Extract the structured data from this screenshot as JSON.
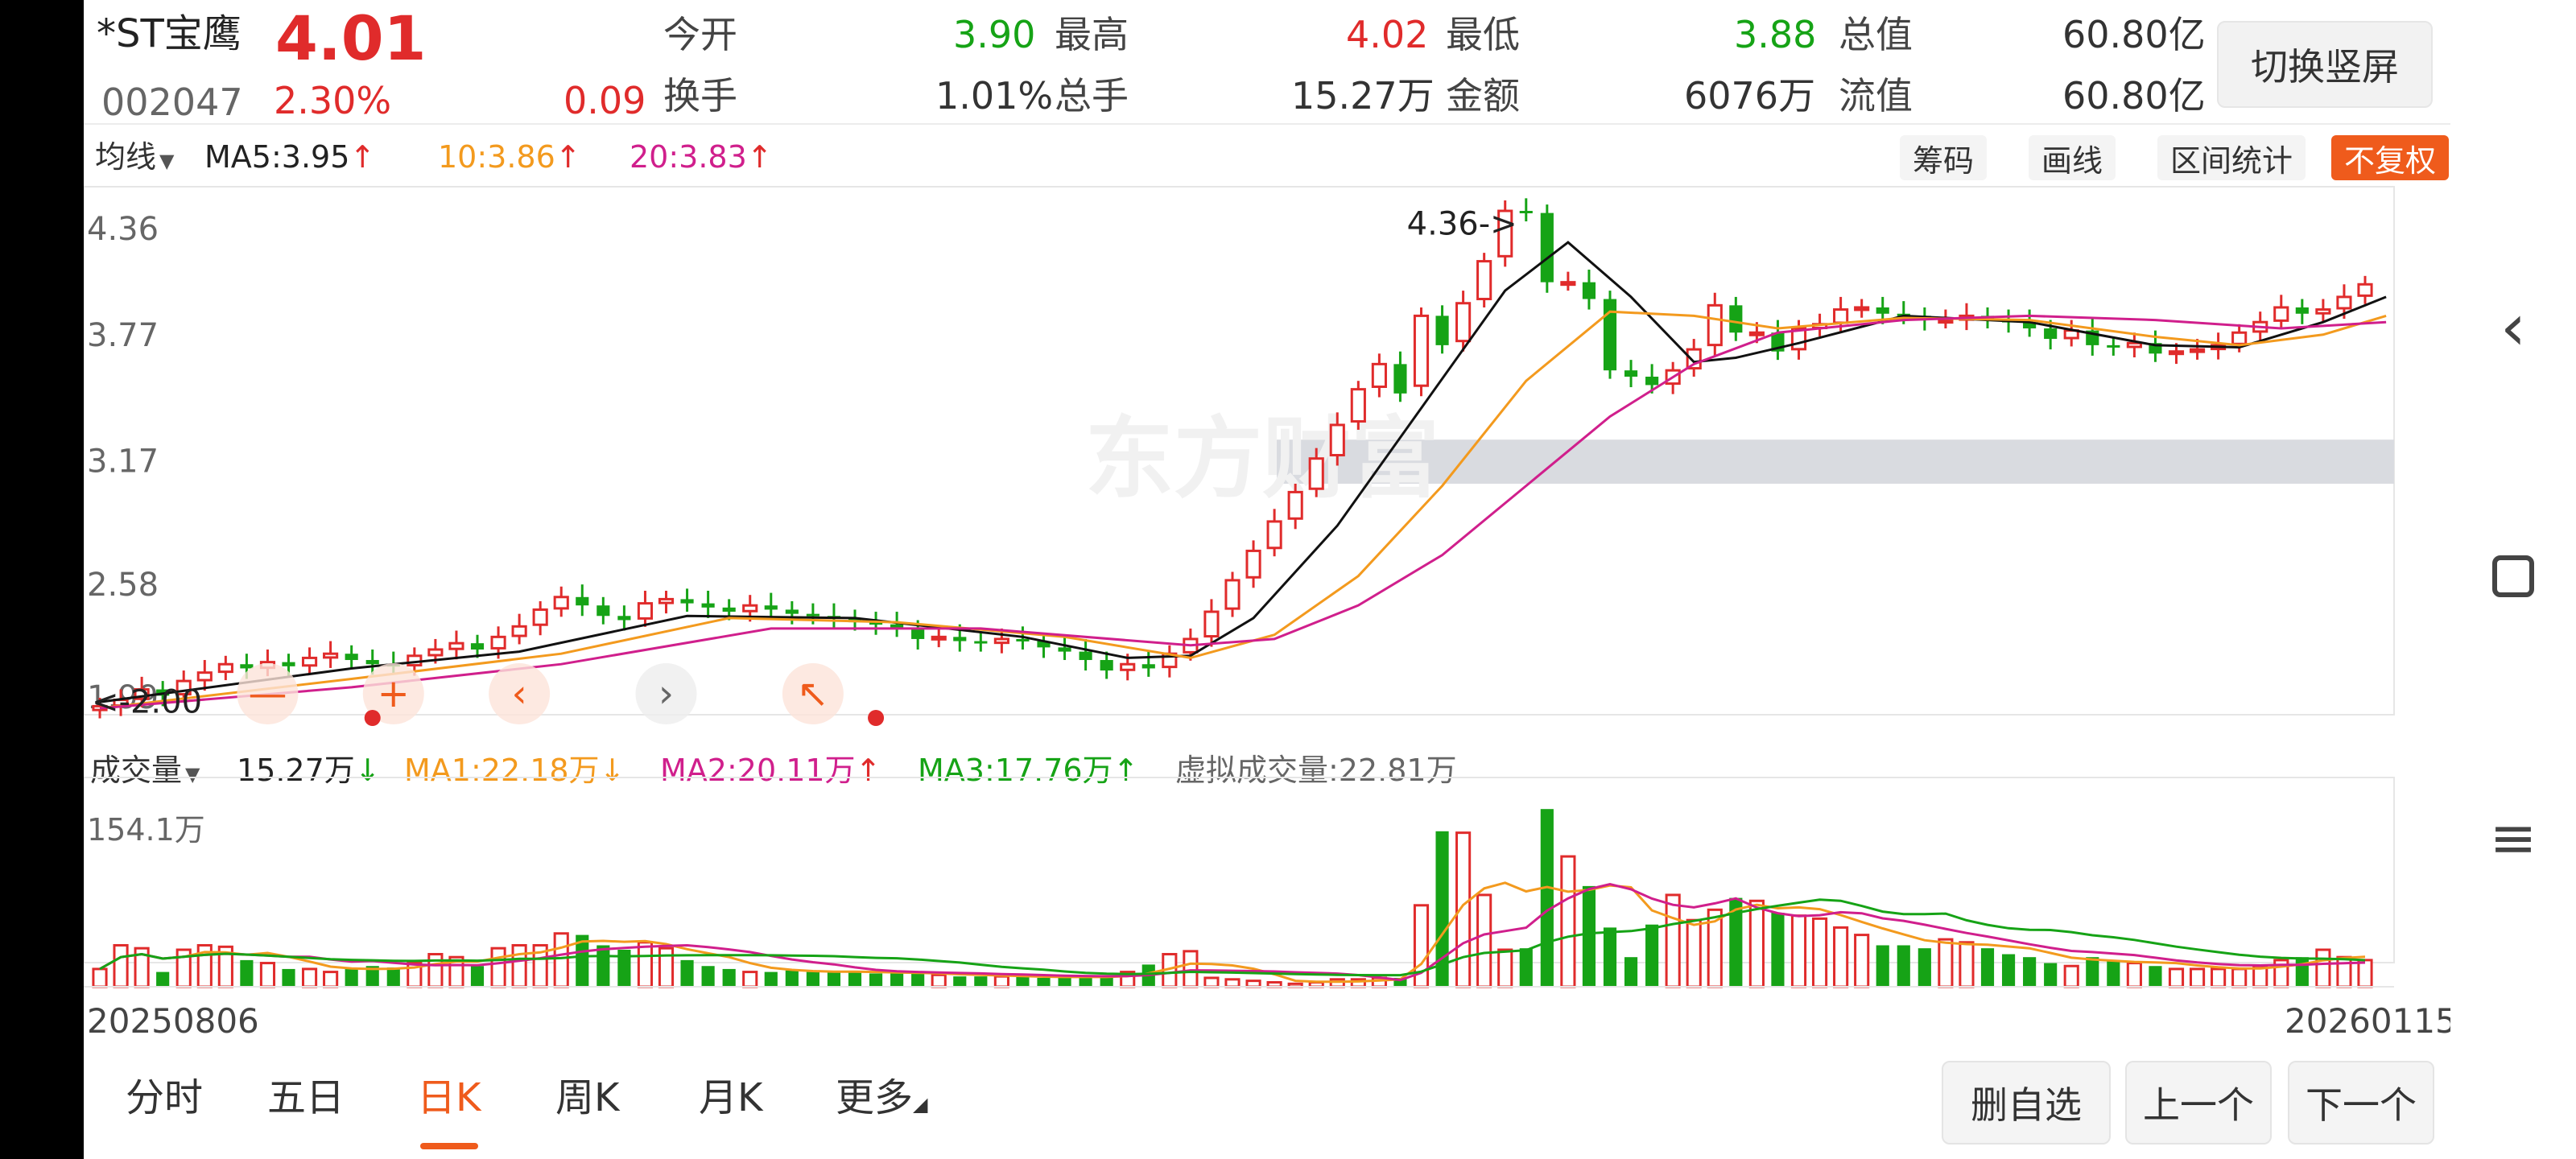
{
  "header": {
    "name": "*ST宝鹰",
    "price": "4.01",
    "code": "002047",
    "change_pct": "2.30%",
    "change": "0.09",
    "open_label": "今开",
    "open": "3.90",
    "high_label": "最高",
    "high": "4.02",
    "low_label": "最低",
    "low": "3.88",
    "mcap_label": "总值",
    "mcap": "60.80亿",
    "turnover_label": "换手",
    "turnover": "1.01%",
    "vol_label": "总手",
    "vol": "15.27万",
    "amount_label": "金额",
    "amount": "6076万",
    "float_label": "流值",
    "float": "60.80亿",
    "switch_label": "切换竖屏"
  },
  "price_bar": {
    "selector": "均线",
    "ma5": "MA5:3.95",
    "ma10": "10:3.86",
    "ma20": "20:3.83",
    "tools": [
      "筹码",
      "画线",
      "区间统计",
      "不复权"
    ]
  },
  "volume_bar": {
    "selector": "成交量",
    "current": "15.27万",
    "ma1": "MA1:22.18万",
    "ma2": "MA2:20.11万",
    "ma3": "MA3:17.76万",
    "virtual": "虚拟成交量:22.81万"
  },
  "dates": {
    "start": "20250806",
    "end": "20260115"
  },
  "tabs": [
    "分时",
    "五日",
    "日K",
    "周K",
    "月K",
    "更多"
  ],
  "active_tab": "日K",
  "bottom_buttons": [
    "删自选",
    "上一个",
    "下一个"
  ],
  "colors": {
    "up": "#e02b2b",
    "down": "#16a316",
    "ma5": "#111111",
    "ma10": "#f39a1e",
    "ma20": "#d01f8c",
    "accent": "#ef5b1c"
  },
  "chart_data": {
    "type": "candlestick",
    "y_ticks": [
      4.36,
      3.77,
      3.17,
      2.58,
      1.99
    ],
    "ylim": [
      1.99,
      4.36
    ],
    "annotations": [
      "4.36->",
      "<-2.00"
    ],
    "closes": [
      2.0,
      2.03,
      2.08,
      2.05,
      2.12,
      2.16,
      2.2,
      2.18,
      2.21,
      2.19,
      2.23,
      2.25,
      2.22,
      2.2,
      2.19,
      2.24,
      2.27,
      2.3,
      2.27,
      2.33,
      2.38,
      2.46,
      2.52,
      2.48,
      2.43,
      2.41,
      2.49,
      2.51,
      2.49,
      2.47,
      2.45,
      2.48,
      2.46,
      2.44,
      2.43,
      2.42,
      2.4,
      2.39,
      2.37,
      2.32,
      2.33,
      2.31,
      2.3,
      2.32,
      2.31,
      2.28,
      2.26,
      2.22,
      2.17,
      2.2,
      2.18,
      2.25,
      2.32,
      2.45,
      2.6,
      2.74,
      2.88,
      3.02,
      3.18,
      3.34,
      3.51,
      3.63,
      3.49,
      3.86,
      3.72,
      3.92,
      4.12,
      4.36,
      4.35,
      4.02,
      4.02,
      3.94,
      3.6,
      3.57,
      3.53,
      3.6,
      3.7,
      3.91,
      3.78,
      3.78,
      3.69,
      3.8,
      3.82,
      3.89,
      3.9,
      3.87,
      3.86,
      3.84,
      3.84,
      3.86,
      3.84,
      3.83,
      3.8,
      3.75,
      3.79,
      3.72,
      3.71,
      3.73,
      3.68,
      3.69,
      3.7,
      3.72,
      3.78,
      3.83,
      3.9,
      3.87,
      3.89,
      3.95,
      4.01
    ],
    "ma_series": [
      {
        "name": "MA5",
        "points": [
          [
            0,
            2.02
          ],
          [
            12,
            2.18
          ],
          [
            20,
            2.26
          ],
          [
            28,
            2.43
          ],
          [
            36,
            2.42
          ],
          [
            44,
            2.33
          ],
          [
            49,
            2.23
          ],
          [
            52,
            2.24
          ],
          [
            55,
            2.42
          ],
          [
            59,
            2.86
          ],
          [
            63,
            3.42
          ],
          [
            67,
            3.98
          ],
          [
            70,
            4.21
          ],
          [
            73,
            3.95
          ],
          [
            76,
            3.64
          ],
          [
            78,
            3.66
          ],
          [
            81,
            3.73
          ],
          [
            86,
            3.86
          ],
          [
            92,
            3.83
          ],
          [
            98,
            3.72
          ],
          [
            102,
            3.71
          ],
          [
            106,
            3.83
          ],
          [
            109,
            3.95
          ]
        ]
      },
      {
        "name": "MA10",
        "points": [
          [
            0,
            1.99
          ],
          [
            12,
            2.13
          ],
          [
            22,
            2.25
          ],
          [
            30,
            2.42
          ],
          [
            38,
            2.4
          ],
          [
            46,
            2.33
          ],
          [
            52,
            2.23
          ],
          [
            56,
            2.34
          ],
          [
            60,
            2.62
          ],
          [
            64,
            3.05
          ],
          [
            68,
            3.55
          ],
          [
            72,
            3.88
          ],
          [
            76,
            3.86
          ],
          [
            80,
            3.8
          ],
          [
            86,
            3.85
          ],
          [
            92,
            3.84
          ],
          [
            98,
            3.76
          ],
          [
            102,
            3.72
          ],
          [
            106,
            3.77
          ],
          [
            109,
            3.86
          ]
        ]
      },
      {
        "name": "MA20",
        "points": [
          [
            0,
            1.99
          ],
          [
            12,
            2.09
          ],
          [
            22,
            2.2
          ],
          [
            32,
            2.37
          ],
          [
            42,
            2.37
          ],
          [
            52,
            2.29
          ],
          [
            56,
            2.32
          ],
          [
            60,
            2.48
          ],
          [
            64,
            2.72
          ],
          [
            68,
            3.05
          ],
          [
            72,
            3.38
          ],
          [
            76,
            3.63
          ],
          [
            80,
            3.78
          ],
          [
            86,
            3.84
          ],
          [
            92,
            3.86
          ],
          [
            98,
            3.84
          ],
          [
            104,
            3.8
          ],
          [
            109,
            3.83
          ]
        ]
      }
    ],
    "volume": {
      "ylim_top": "154.1万",
      "series": [
        {
          "name": "MA1"
        },
        {
          "name": "MA2"
        },
        {
          "name": "MA3"
        }
      ],
      "values": [
        0.12,
        0.28,
        0.26,
        0.1,
        0.25,
        0.28,
        0.27,
        0.18,
        0.16,
        0.12,
        0.12,
        0.1,
        0.12,
        0.14,
        0.13,
        0.16,
        0.22,
        0.2,
        0.14,
        0.26,
        0.28,
        0.28,
        0.36,
        0.35,
        0.28,
        0.25,
        0.3,
        0.26,
        0.18,
        0.14,
        0.12,
        0.1,
        0.1,
        0.11,
        0.1,
        0.1,
        0.1,
        0.09,
        0.09,
        0.09,
        0.08,
        0.07,
        0.07,
        0.07,
        0.07,
        0.06,
        0.06,
        0.07,
        0.07,
        0.1,
        0.15,
        0.22,
        0.24,
        0.06,
        0.05,
        0.04,
        0.03,
        0.02,
        0.03,
        0.05,
        0.05,
        0.06,
        0.06,
        0.55,
        1.05,
        1.04,
        0.62,
        0.25,
        0.26,
        1.2,
        0.88,
        0.68,
        0.4,
        0.2,
        0.42,
        0.62,
        0.45,
        0.52,
        0.6,
        0.58,
        0.5,
        0.48,
        0.46,
        0.4,
        0.35,
        0.28,
        0.28,
        0.26,
        0.32,
        0.3,
        0.26,
        0.22,
        0.2,
        0.16,
        0.14,
        0.2,
        0.18,
        0.16,
        0.14,
        0.12,
        0.12,
        0.12,
        0.12,
        0.14,
        0.18,
        0.2,
        0.25,
        0.2,
        0.18
      ]
    }
  }
}
